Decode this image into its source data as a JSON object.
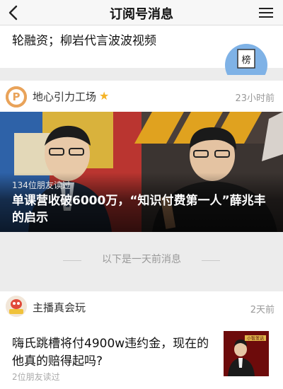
{
  "nav": {
    "title": "订阅号消息"
  },
  "top_item": {
    "text": "轮融资；柳岩代言波波视频",
    "badge_label": "榜"
  },
  "main_item": {
    "account_name": "地心引力工场",
    "time": "23小时前",
    "readers": "134位朋友读过",
    "headline": "单课营收破6000万，“知识付费第一人”薛兆丰的启示",
    "avatar_letter": "P"
  },
  "divider": {
    "text": "以下是一天前消息"
  },
  "bottom_item": {
    "account_name": "主播真会玩",
    "time": "2天前",
    "title": "嗨氏跳槽将付4900w违约金，现在的他真的赔得起吗?",
    "readers": "2位朋友读过",
    "thumb_text": "小智发话"
  },
  "colors": {
    "star": "#f5b326",
    "badge": "#7fb2e6",
    "meta_gray": "#999999"
  },
  "icons": {
    "back": "back-chevron-icon",
    "menu": "menu-icon",
    "star": "star-icon"
  }
}
